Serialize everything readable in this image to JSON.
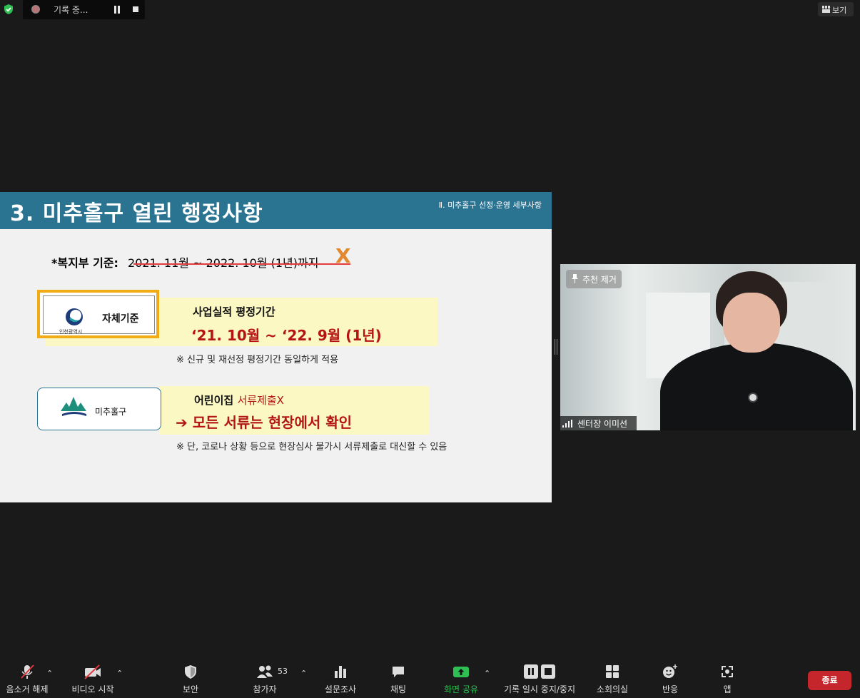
{
  "recording": {
    "status": "기록 중...",
    "pause_icon": "pause-icon",
    "stop_icon": "stop-icon"
  },
  "view_button": {
    "label": "보기"
  },
  "slide": {
    "title": "3. 미추홀구 열린 행정사항",
    "section": "Ⅱ. 미추홀구 선정·운영 세부사항",
    "criteria_label": "*복지부 기준:",
    "criteria_old": "2021. 11월 ~ 2022. 10월 (1년)까지",
    "criteria_mark": "X",
    "logo1_city": "인천광역시",
    "logo1_text": "자체기준",
    "perf_label": "사업실적 평정기간",
    "perf_range": "‘21. 10월  ~ ‘22. 9월 (1년)",
    "note1": "※ 신규 및 재선정  평정기간 동일하게  적용",
    "logo2_text": "미추홀구",
    "nursery_label": "어린이집 ",
    "nursery_red": "서류제출X",
    "arrow_text": "➔ 모든 서류는 현장에서 확인",
    "note2": "※ 단, 코로나 상황 등으로  현장심사 불가시 서류제출로 대신할 수 있음",
    "colors": {
      "header": "#2a7391",
      "highlight": "#fbf8c4",
      "red": "#b51414",
      "orange": "#e2892d"
    }
  },
  "video": {
    "pin_label": "추천 제거",
    "participant_name": "센터장 이미선"
  },
  "toolbar": {
    "mute": "음소거 해제",
    "video": "비디오 시작",
    "security": "보안",
    "participants": "참가자",
    "participants_count": "53",
    "polls": "설문조사",
    "chat": "채팅",
    "share": "화면 공유",
    "recording": "기록 일시 중지/중지",
    "breakout": "소회의실",
    "reactions": "반응",
    "apps": "앱",
    "end": "종료"
  }
}
